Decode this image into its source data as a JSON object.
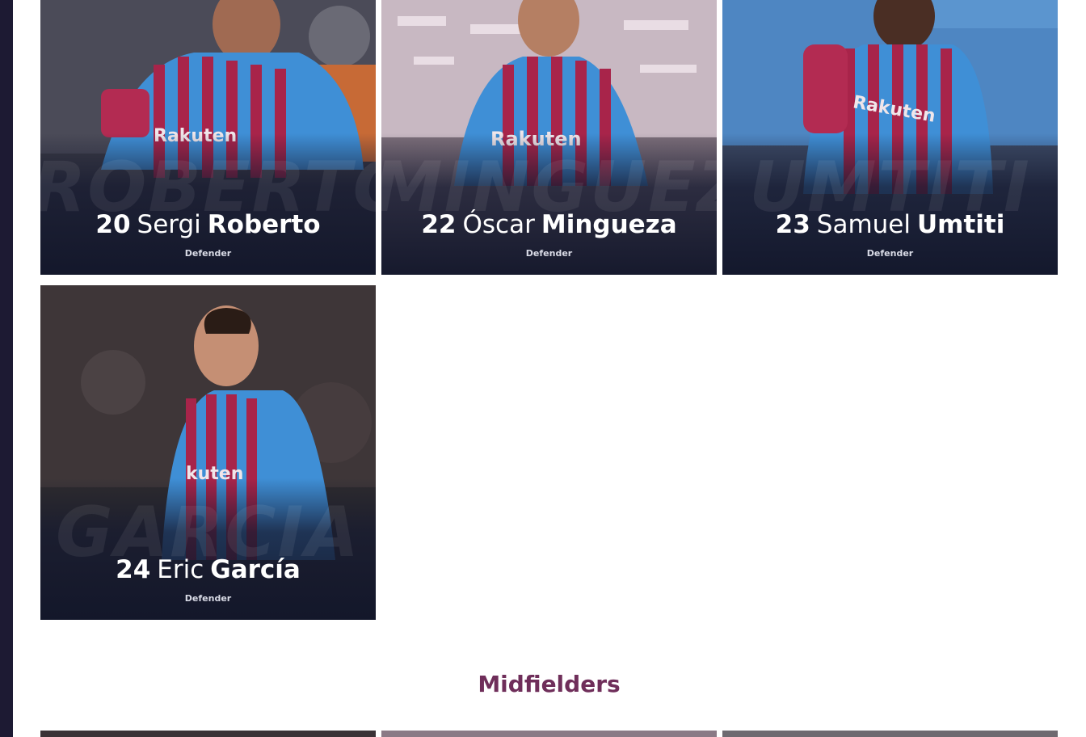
{
  "players": [
    {
      "number": "20",
      "first": "Sergi",
      "last": "Roberto",
      "position": "Defender",
      "ghost": "ROBERTO"
    },
    {
      "number": "22",
      "first": "Óscar",
      "last": "Mingueza",
      "position": "Defender",
      "ghost": "MINGUEZA"
    },
    {
      "number": "23",
      "first": "Samuel",
      "last": "Umtiti",
      "position": "Defender",
      "ghost": "UMTITI"
    },
    {
      "number": "24",
      "first": "Eric",
      "last": "García",
      "position": "Defender",
      "ghost": "GARCIA"
    }
  ],
  "section": {
    "title": "Midfielders"
  },
  "colors": {
    "accent": "#6f2e5a",
    "kit_blue": "#3f8fd6",
    "kit_red": "#a8244a",
    "card_bg": "#1b2038"
  },
  "icons": [
    "nike-logo-icon",
    "fcb-crest-icon"
  ]
}
